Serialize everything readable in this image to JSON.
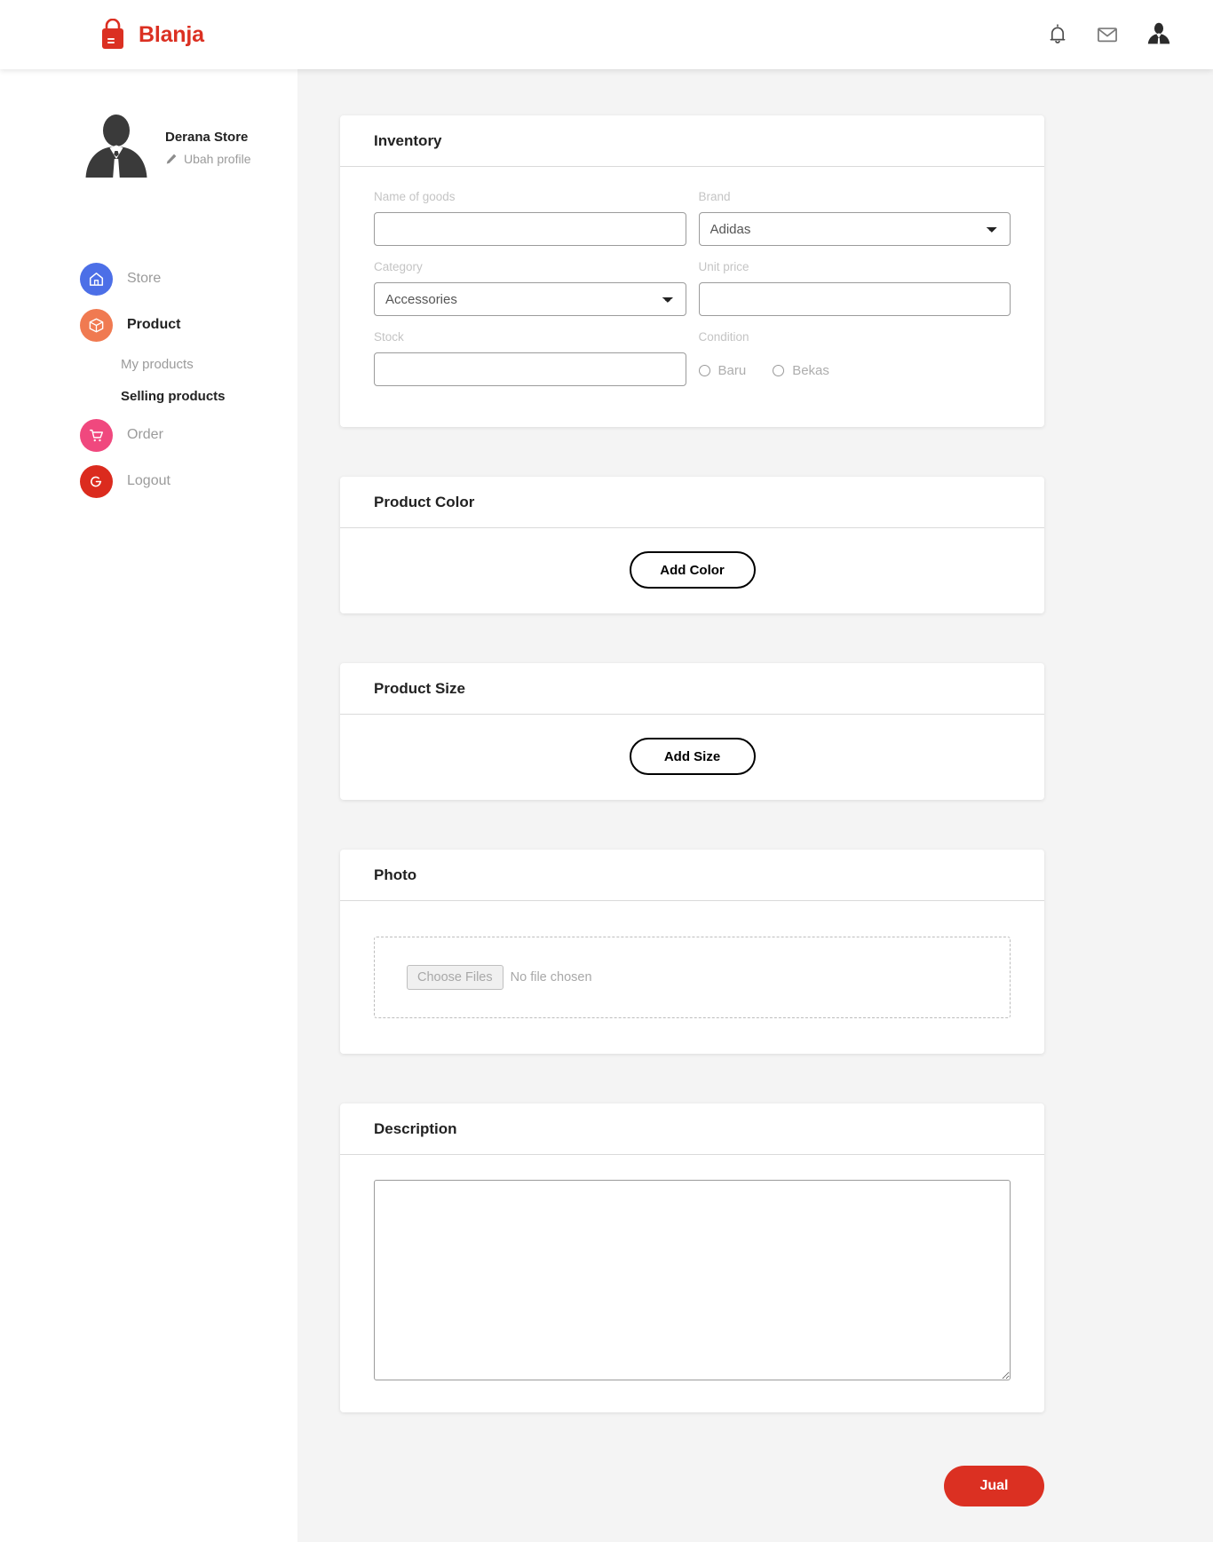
{
  "header": {
    "brand_name": "Blanja",
    "brand_color": "#DB3022",
    "icons": [
      "notification-bell-icon",
      "message-envelope-icon",
      "user-avatar-icon"
    ]
  },
  "sidebar": {
    "profile": {
      "name": "Derana Store",
      "edit_label": "Ubah profile"
    },
    "items": [
      {
        "label": "Store",
        "icon": "home-icon",
        "color": "#4C6FE7",
        "active": false
      },
      {
        "label": "Product",
        "icon": "box-icon",
        "color": "#F07A51",
        "active": true
      },
      {
        "label": "Order",
        "icon": "cart-icon",
        "color": "#F0487E",
        "active": false
      },
      {
        "label": "Logout",
        "icon": "power-icon",
        "color": "#DB2B1E",
        "active": false
      }
    ],
    "sub_items": [
      {
        "label": "My products",
        "active": false
      },
      {
        "label": "Selling products",
        "active": true
      }
    ]
  },
  "main": {
    "inventory": {
      "title": "Inventory",
      "fields": {
        "name_of_goods": {
          "label": "Name of goods",
          "value": "",
          "placeholder": ""
        },
        "brand": {
          "label": "Brand",
          "selected": "Adidas",
          "options": [
            "Adidas"
          ]
        },
        "category": {
          "label": "Category",
          "selected": "Accessories",
          "options": [
            "Accessories"
          ]
        },
        "unit_price": {
          "label": "Unit price",
          "value": "",
          "placeholder": ""
        },
        "stock": {
          "label": "Stock",
          "value": "",
          "placeholder": ""
        },
        "condition": {
          "label": "Condition",
          "options": [
            {
              "label": "Baru",
              "checked": false
            },
            {
              "label": "Bekas",
              "checked": false
            }
          ]
        }
      }
    },
    "product_color": {
      "title": "Product Color",
      "add_button": "Add Color"
    },
    "product_size": {
      "title": "Product Size",
      "add_button": "Add Size"
    },
    "photo": {
      "title": "Photo",
      "choose_files_label": "Choose Files",
      "file_status": "No file chosen"
    },
    "description": {
      "title": "Description",
      "value": "",
      "placeholder": ""
    },
    "submit_label": "Jual"
  }
}
